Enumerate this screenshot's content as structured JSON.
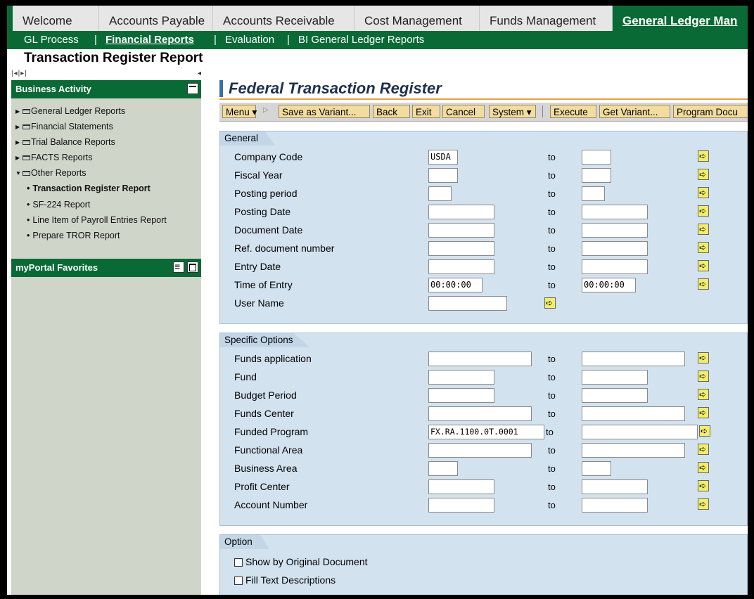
{
  "top_tabs": [
    {
      "label": "Welcome",
      "active": false
    },
    {
      "label": "Accounts Payable",
      "active": false
    },
    {
      "label": "Accounts Receivable",
      "active": false
    },
    {
      "label": "Cost Management",
      "active": false
    },
    {
      "label": "Funds Management",
      "active": false
    },
    {
      "label": "General Ledger Man",
      "active": true
    }
  ],
  "sub_nav": {
    "items": [
      "GL Process",
      "Financial Reports",
      "Evaluation",
      "BI General Ledger Reports"
    ],
    "selected": "Financial Reports",
    "sep": "|"
  },
  "page_title": "Transaction Register Report",
  "mini_nav": "|◂|▸|",
  "sidebar": {
    "business_activity_title": "Business Activity",
    "items": [
      {
        "label": "General Ledger Reports"
      },
      {
        "label": "Financial Statements"
      },
      {
        "label": "Trial Balance Reports"
      },
      {
        "label": "FACTS Reports"
      },
      {
        "label": "Other Reports"
      }
    ],
    "sub_items": [
      {
        "label": "Transaction Register Report",
        "current": true
      },
      {
        "label": "SF-224 Report",
        "current": false
      },
      {
        "label": "Line Item of Payroll Entries Report",
        "current": false
      },
      {
        "label": "Prepare TROR Report",
        "current": false
      }
    ],
    "favorites_title": "myPortal Favorites"
  },
  "main": {
    "title": "Federal Transaction Register",
    "toolbar": [
      "Menu",
      "Save as Variant...",
      "Back",
      "Exit",
      "Cancel",
      "System",
      "Execute",
      "Get Variant...",
      "Program Docu"
    ],
    "to_label": "to",
    "general": {
      "title": "General",
      "fields": [
        {
          "label": "Company Code",
          "from": "USDA",
          "to": ""
        },
        {
          "label": "Fiscal Year",
          "from": "",
          "to": ""
        },
        {
          "label": "Posting period",
          "from": "",
          "to": ""
        },
        {
          "label": "Posting Date",
          "from": "",
          "to": ""
        },
        {
          "label": "Document Date",
          "from": "",
          "to": ""
        },
        {
          "label": "Ref. document number",
          "from": "",
          "to": ""
        },
        {
          "label": "Entry Date",
          "from": "",
          "to": ""
        },
        {
          "label": "Time of Entry",
          "from": "00:00:00",
          "to": "00:00:00"
        },
        {
          "label": "User Name",
          "from": ""
        }
      ]
    },
    "specific": {
      "title": "Specific Options",
      "fields": [
        {
          "label": "Funds application",
          "from": "",
          "to": ""
        },
        {
          "label": "Fund",
          "from": "",
          "to": ""
        },
        {
          "label": "Budget Period",
          "from": "",
          "to": ""
        },
        {
          "label": "Funds Center",
          "from": "",
          "to": ""
        },
        {
          "label": "Funded Program",
          "from": "FX.RA.1100.0T.0001",
          "to": ""
        },
        {
          "label": "Functional Area",
          "from": "",
          "to": ""
        },
        {
          "label": "Business Area",
          "from": "",
          "to": ""
        },
        {
          "label": "Profit Center",
          "from": "",
          "to": ""
        },
        {
          "label": "Account Number",
          "from": "",
          "to": ""
        }
      ]
    },
    "option": {
      "title": "Option",
      "checkboxes": [
        {
          "label": "Show by Original Document",
          "checked": false
        },
        {
          "label": "Fill Text Descriptions",
          "checked": false
        }
      ]
    }
  }
}
